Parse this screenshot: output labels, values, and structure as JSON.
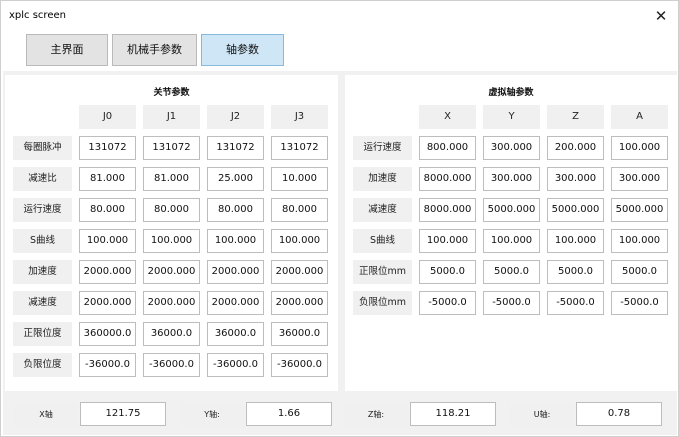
{
  "window": {
    "title": "xplc screen",
    "close_glyph": "✕"
  },
  "tabs": [
    {
      "label": "主界面"
    },
    {
      "label": "机械手参数"
    },
    {
      "label": "轴参数"
    }
  ],
  "left_panel": {
    "title": "关节参数",
    "columns": [
      "J0",
      "J1",
      "J2",
      "J3"
    ],
    "rows": [
      {
        "label": "每圈脉冲",
        "values": [
          "131072",
          "131072",
          "131072",
          "131072"
        ]
      },
      {
        "label": "减速比",
        "values": [
          "81.000",
          "81.000",
          "25.000",
          "10.000"
        ]
      },
      {
        "label": "运行速度",
        "values": [
          "80.000",
          "80.000",
          "80.000",
          "80.000"
        ]
      },
      {
        "label": "S曲线",
        "values": [
          "100.000",
          "100.000",
          "100.000",
          "100.000"
        ]
      },
      {
        "label": "加速度",
        "values": [
          "2000.000",
          "2000.000",
          "2000.000",
          "2000.000"
        ]
      },
      {
        "label": "减速度",
        "values": [
          "2000.000",
          "2000.000",
          "2000.000",
          "2000.000"
        ]
      },
      {
        "label": "正限位度",
        "values": [
          "360000.0",
          "36000.0",
          "36000.0",
          "36000.0"
        ]
      },
      {
        "label": "负限位度",
        "values": [
          "-36000.0",
          "-36000.0",
          "-36000.0",
          "-36000.0"
        ]
      }
    ]
  },
  "right_panel": {
    "title": "虚拟轴参数",
    "columns": [
      "X",
      "Y",
      "Z",
      "A"
    ],
    "rows": [
      {
        "label": "运行速度",
        "values": [
          "800.000",
          "300.000",
          "200.000",
          "100.000"
        ]
      },
      {
        "label": "加速度",
        "values": [
          "8000.000",
          "300.000",
          "300.000",
          "300.000"
        ]
      },
      {
        "label": "减速度",
        "values": [
          "8000.000",
          "5000.000",
          "5000.000",
          "5000.000"
        ]
      },
      {
        "label": "S曲线",
        "values": [
          "100.000",
          "100.000",
          "100.000",
          "100.000"
        ]
      },
      {
        "label": "正限位mm",
        "values": [
          "5000.0",
          "5000.0",
          "5000.0",
          "5000.0"
        ]
      },
      {
        "label": "负限位mm",
        "values": [
          "-5000.0",
          "-5000.0",
          "-5000.0",
          "-5000.0"
        ]
      }
    ]
  },
  "footer": [
    {
      "label": "X轴",
      "value": "121.75"
    },
    {
      "label": "Y轴:",
      "value": "1.66"
    },
    {
      "label": "Z轴:",
      "value": "118.21"
    },
    {
      "label": "U轴:",
      "value": "0.78"
    }
  ],
  "colors": {
    "active_tab": "#cfe6f6",
    "panel_bg": "#f1f1f1",
    "label_bg": "#f0f0f0"
  }
}
